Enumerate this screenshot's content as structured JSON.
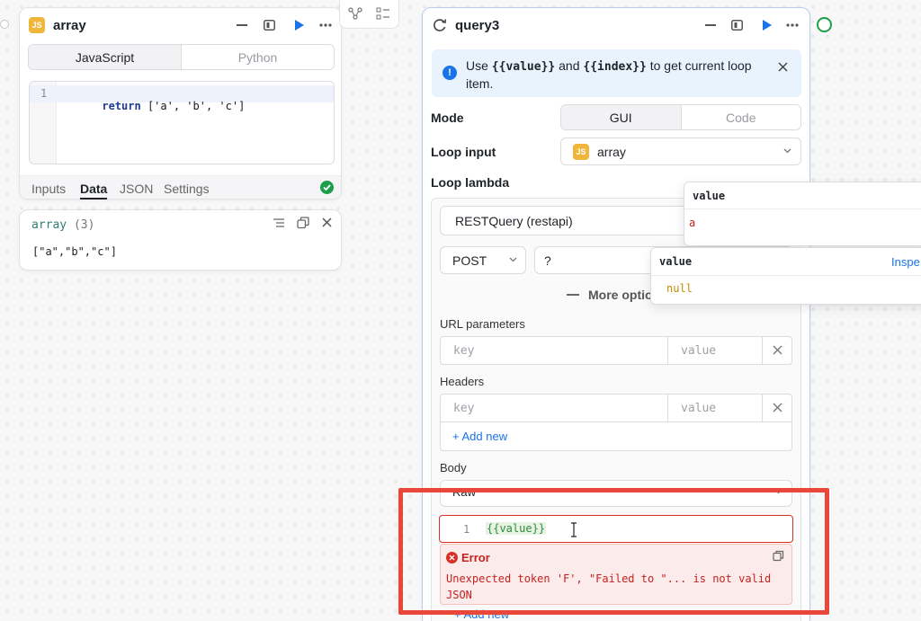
{
  "array_panel": {
    "title": "array",
    "badge": "JS",
    "lang_tabs": [
      "JavaScript",
      "Python"
    ],
    "code_line_no": "1",
    "code_keyword": "return",
    "code_rest": " ['a', 'b', 'c']",
    "bottom_tabs": [
      "Inputs",
      "Data",
      "JSON",
      "Settings"
    ],
    "active_tab": "Data"
  },
  "result_panel": {
    "name": "array",
    "count": "(3)",
    "value": "[\"a\",\"b\",\"c\"]"
  },
  "query_panel": {
    "title": "query3",
    "info_text_a": "Use ",
    "info_code_1": "{{value}}",
    "info_text_b": " and ",
    "info_code_2": "{{index}}",
    "info_text_c": " to get current loop item.",
    "mode_label": "Mode",
    "mode_options": [
      "GUI",
      "Code"
    ],
    "loop_input_label": "Loop input",
    "loop_input_value": "array",
    "loop_input_badge": "JS",
    "loop_lambda_label": "Loop lambda",
    "query_select": "RESTQuery (restapi)",
    "method": "POST",
    "url": "?",
    "more_options": "More optio",
    "url_params_label": "URL parameters",
    "key_placeholder": "key",
    "value_placeholder": "value",
    "headers_label": "Headers",
    "add_new": "+ Add new",
    "body_label": "Body",
    "body_type": "Raw",
    "body_line_no": "1",
    "body_code": "{{value}}",
    "error_title": "Error",
    "error_message": "Unexpected token 'F', \"Failed to \"... is not valid JSON",
    "add_new_hidden": "+ Add new"
  },
  "tooltip1": {
    "title": "value",
    "value": "a"
  },
  "tooltip2": {
    "title": "value",
    "inspect": "Inspe",
    "value": "null"
  },
  "colors": {
    "accent": "#1a73e8",
    "error": "#d93025",
    "highlight_box": "#e8473a",
    "js_badge": "#f0b63a",
    "success": "#1e9e4a"
  }
}
